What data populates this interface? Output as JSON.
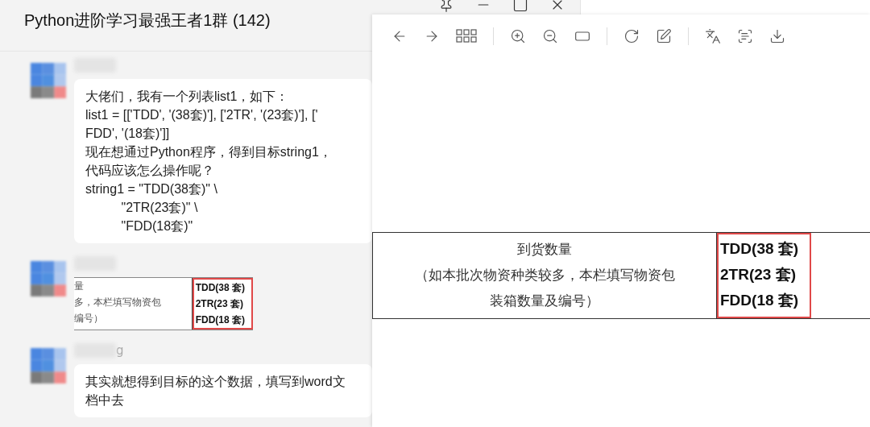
{
  "chat": {
    "title": "Python进阶学习最强王者1群 (142)",
    "messages": [
      {
        "kind": "text",
        "lines": [
          "大佬们，我有一个列表list1，如下：",
          "list1 = [['TDD', '(38套)'], ['2TR', '(23套)'], ['",
          "FDD', '(18套)']]",
          "现在想通过Python程序，得到目标string1，",
          "代码应该怎么操作呢？",
          "string1 = \"TDD(38套)\" \\",
          "          \"2TR(23套)\" \\",
          "          \"FDD(18套)\""
        ]
      },
      {
        "kind": "image",
        "left_lines": [
          "量",
          "多，本栏填写物资包",
          "编号）"
        ],
        "right_lines": [
          "TDD(38 套)",
          "2TR(23 套)",
          "FDD(18 套)"
        ]
      },
      {
        "kind": "text",
        "name_shown": "g",
        "lines": [
          "其实就想得到目标的这个数据，填写到word文",
          "档中去"
        ]
      }
    ]
  },
  "viewer": {
    "table": {
      "label_lines": [
        "到货数量",
        "（如本批次物资种类较多，本栏填写物资包",
        "装箱数量及编号）"
      ],
      "values": [
        "TDD(38 套)",
        "2TR(23 套)",
        "FDD(18 套)"
      ]
    }
  }
}
